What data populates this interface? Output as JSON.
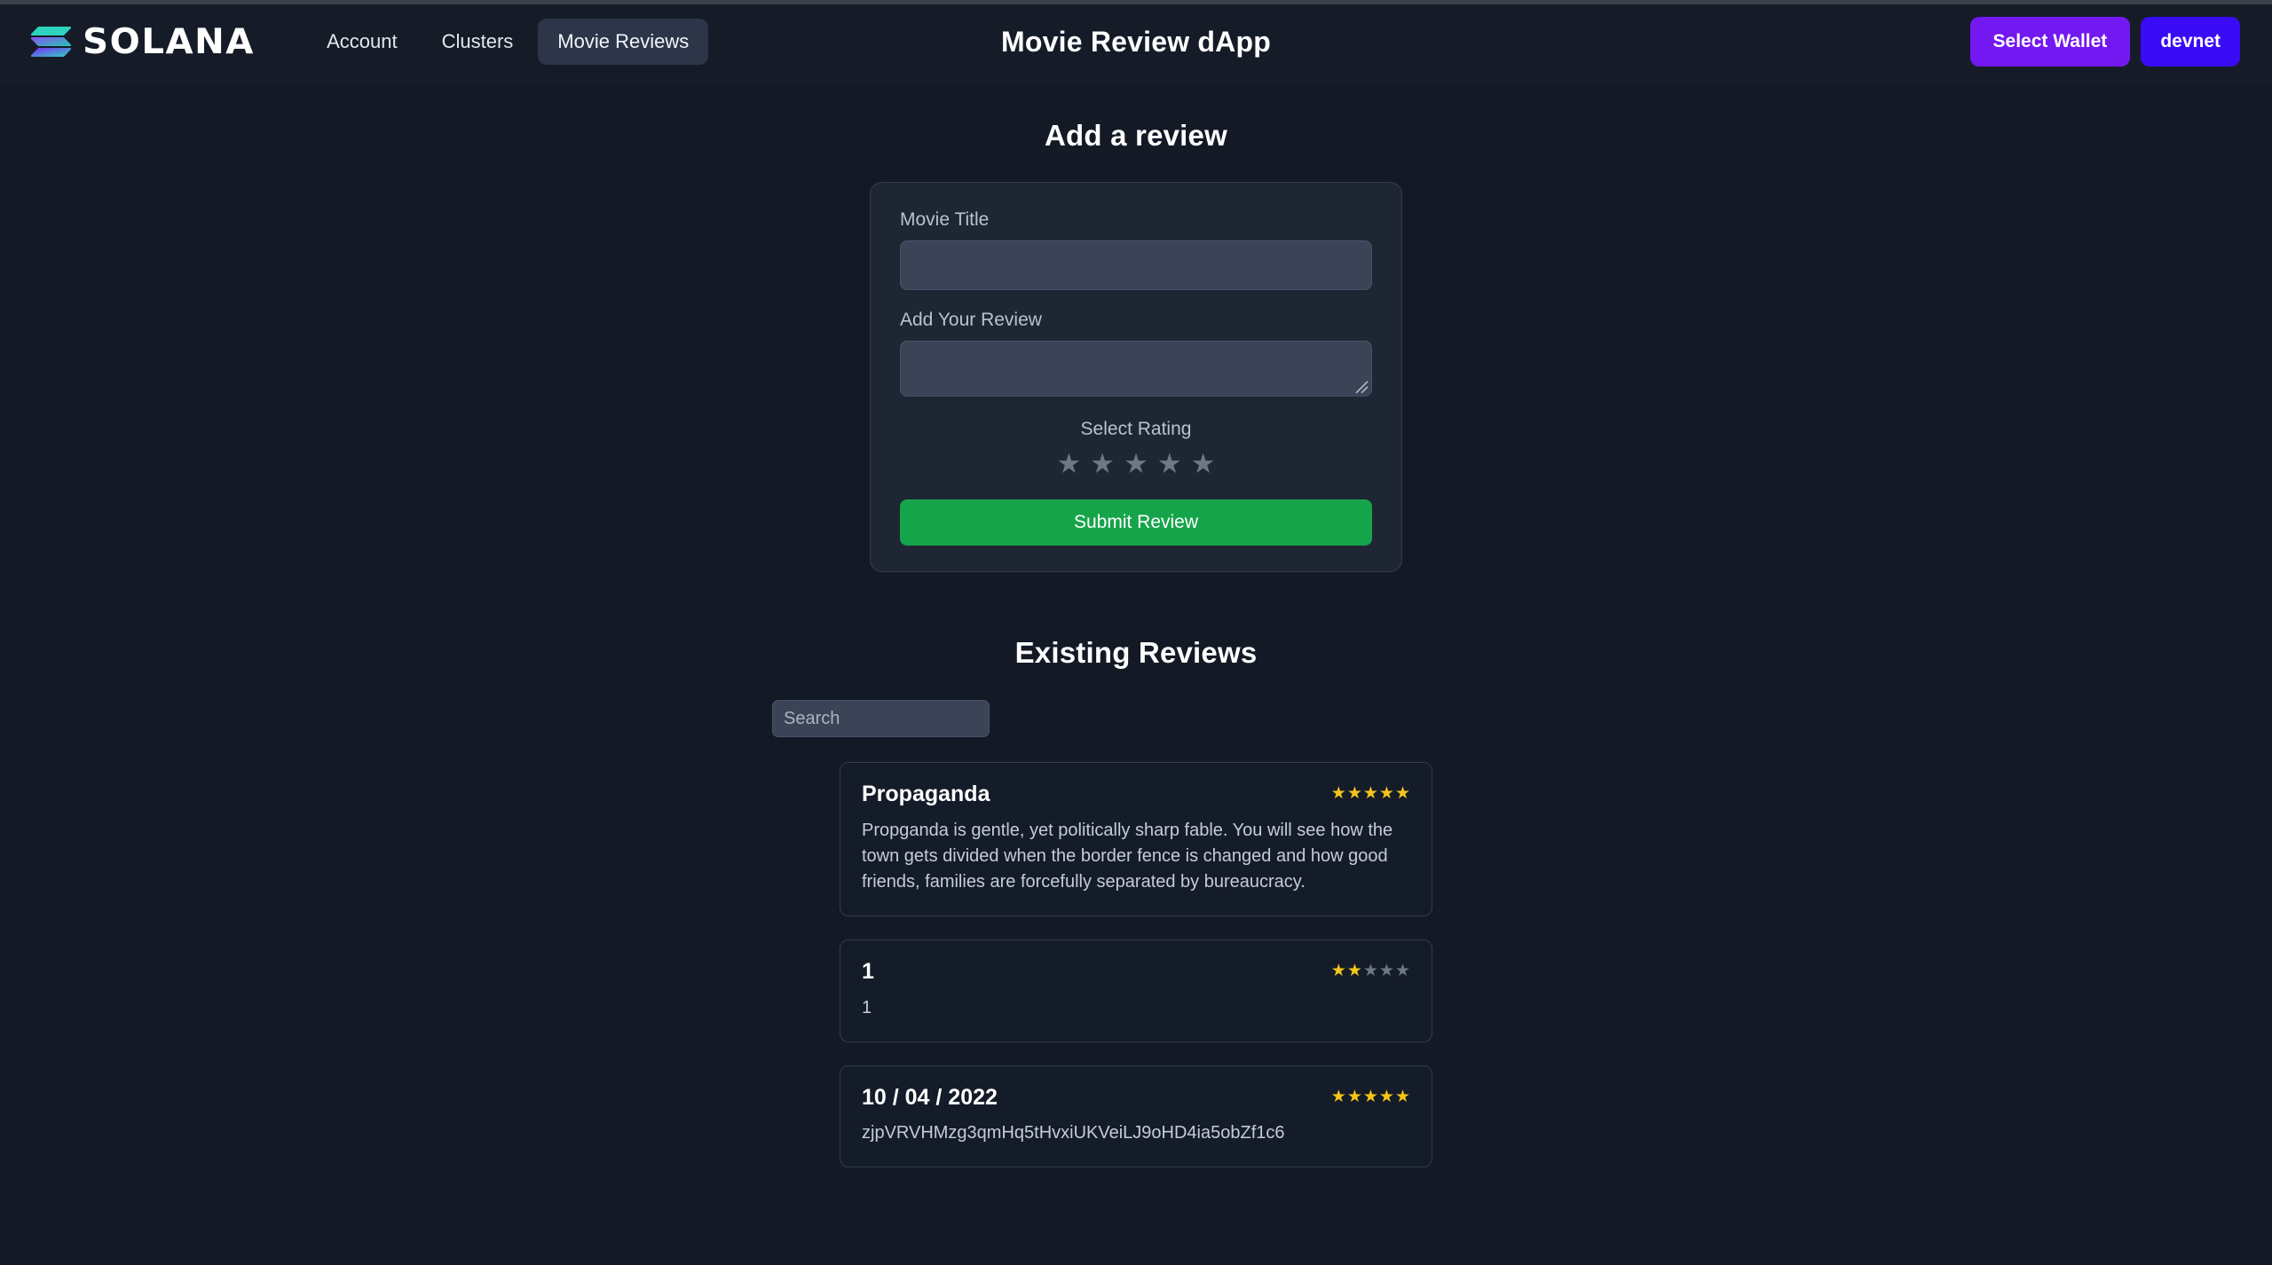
{
  "navbar": {
    "brand_word": "SOLANA",
    "brand_logo_icon": "solana-logo-icon",
    "title": "Movie Review dApp",
    "links": [
      {
        "label": "Account",
        "active": false
      },
      {
        "label": "Clusters",
        "active": false
      },
      {
        "label": "Movie Reviews",
        "active": true
      }
    ],
    "wallet_button": "Select Wallet",
    "cluster_button": "devnet",
    "colors": {
      "wallet_purple": "#7318f0",
      "cluster_blue": "#3a0bf5",
      "active_tab_bg": "#2d3648"
    }
  },
  "add_review": {
    "heading": "Add a review",
    "title_label": "Movie Title",
    "title_value": "",
    "title_placeholder": "",
    "review_label": "Add Your Review",
    "review_value": "",
    "review_placeholder": "",
    "rating_label": "Select Rating",
    "rating_value": 0,
    "rating_max": 5,
    "rating_star_icon": "star-icon",
    "submit_label": "Submit Review",
    "submit_color": "#16a44a"
  },
  "existing_reviews": {
    "heading": "Existing Reviews",
    "search_value": "",
    "search_placeholder": "Search",
    "star_filled_color": "#f5c518",
    "star_empty_color": "#6e7787",
    "items": [
      {
        "title": "Propaganda",
        "rating": 5,
        "body": "Propganda is gentle, yet politically sharp fable. You will see how the town gets divided when the border fence is changed and how good friends, families are forcefully separated by bureaucracy."
      },
      {
        "title": "1",
        "rating": 2,
        "body": "1"
      },
      {
        "title": "10 / 04 / 2022",
        "rating": 5,
        "body": "zjpVRVHMzg3qmHq5tHvxiUKVeiLJ9oHD4ia5obZf1c6"
      }
    ]
  }
}
